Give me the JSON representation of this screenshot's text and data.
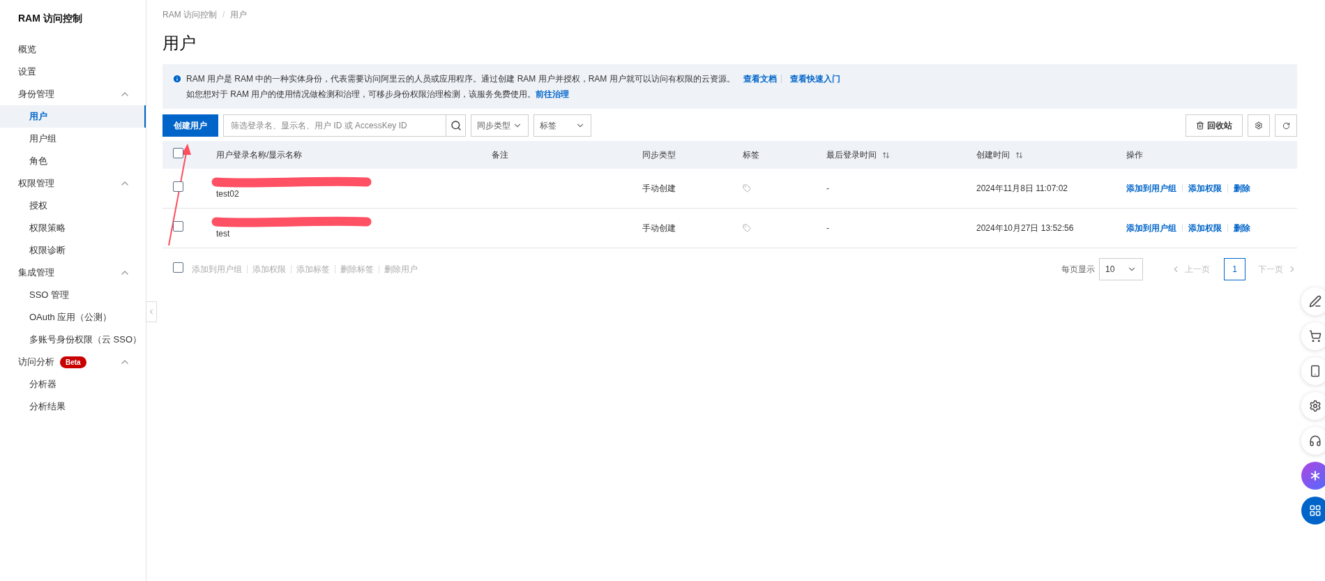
{
  "sidebar": {
    "title": "RAM 访问控制",
    "items": [
      {
        "label": "概览",
        "selected": false
      },
      {
        "label": "设置",
        "selected": false
      },
      {
        "label": "身份管理",
        "selected": false,
        "expanded": true,
        "children": [
          {
            "label": "用户",
            "selected": true
          },
          {
            "label": "用户组",
            "selected": false
          },
          {
            "label": "角色",
            "selected": false
          }
        ]
      },
      {
        "label": "权限管理",
        "selected": false,
        "expanded": true,
        "children": [
          {
            "label": "授权",
            "selected": false
          },
          {
            "label": "权限策略",
            "selected": false
          },
          {
            "label": "权限诊断",
            "selected": false
          }
        ]
      },
      {
        "label": "集成管理",
        "selected": false,
        "expanded": true,
        "children": [
          {
            "label": "SSO 管理",
            "selected": false
          },
          {
            "label": "OAuth 应用（公测）",
            "selected": false
          },
          {
            "label": "多账号身份权限（云 SSO）",
            "selected": false
          }
        ]
      },
      {
        "label": "访问分析",
        "badge": "Beta",
        "selected": false,
        "expanded": true,
        "children": [
          {
            "label": "分析器",
            "selected": false
          },
          {
            "label": "分析结果",
            "selected": false
          }
        ]
      }
    ]
  },
  "breadcrumb": {
    "separator": "/",
    "items": [
      "RAM 访问控制",
      "用户"
    ]
  },
  "page_title": "用户",
  "notice": {
    "line1": "RAM 用户是 RAM 中的一种实体身份，代表需要访问阿里云的人员或应用程序。通过创建 RAM 用户并授权，RAM 用户就可以访问有权限的云资源。",
    "line1_links": [
      "查看文档",
      "查看快速入门"
    ],
    "line2": "如您想对于 RAM 用户的使用情况做检测和治理，可移步身份权限治理检测，该服务免费使用。",
    "line2_link": "前往治理"
  },
  "toolbar": {
    "create_button": "创建用户",
    "search": {
      "placeholder": "筛选登录名、显示名、用户 ID 或 AccessKey ID"
    },
    "filters": [
      "同步类型",
      "标签"
    ],
    "recycle_button": "回收站"
  },
  "table": {
    "select_all_checked": false,
    "columns": [
      {
        "label": "用户登录名称/显示名称",
        "sortable": false
      },
      {
        "label": "备注",
        "sortable": false
      },
      {
        "label": "同步类型",
        "sortable": false
      },
      {
        "label": "标签",
        "sortable": false
      },
      {
        "label": "最后登录时间",
        "sortable": true
      },
      {
        "label": "创建时间",
        "sortable": true
      },
      {
        "label": "操作",
        "sortable": false
      }
    ],
    "rows": [
      {
        "checked": false,
        "redacted": true,
        "name": "test02",
        "sync_type": "手动创建",
        "last_login": "-",
        "created": "2024年11月8日 11:07:02",
        "actions": [
          "添加到用户组",
          "添加权限",
          "删除"
        ]
      },
      {
        "checked": false,
        "redacted": true,
        "name": "test",
        "sync_type": "手动创建",
        "last_login": "-",
        "created": "2024年10月27日 13:52:56",
        "actions": [
          "添加到用户组",
          "添加权限",
          "删除"
        ]
      }
    ]
  },
  "bulk": {
    "checked": false,
    "actions": [
      {
        "label": "添加到用户组",
        "disabled": true
      },
      {
        "label": "添加权限",
        "disabled": true
      },
      {
        "label": "添加标签",
        "disabled": true
      },
      {
        "label": "删除标签",
        "disabled": true
      },
      {
        "label": "删除用户",
        "disabled": true
      }
    ]
  },
  "pagination": {
    "page_size_label": "每页显示",
    "page_size": "10",
    "prev": {
      "label": "上一页",
      "disabled": true
    },
    "pages": [
      {
        "label": "1",
        "selected": true
      }
    ],
    "next": {
      "label": "下一页",
      "disabled": true
    }
  }
}
